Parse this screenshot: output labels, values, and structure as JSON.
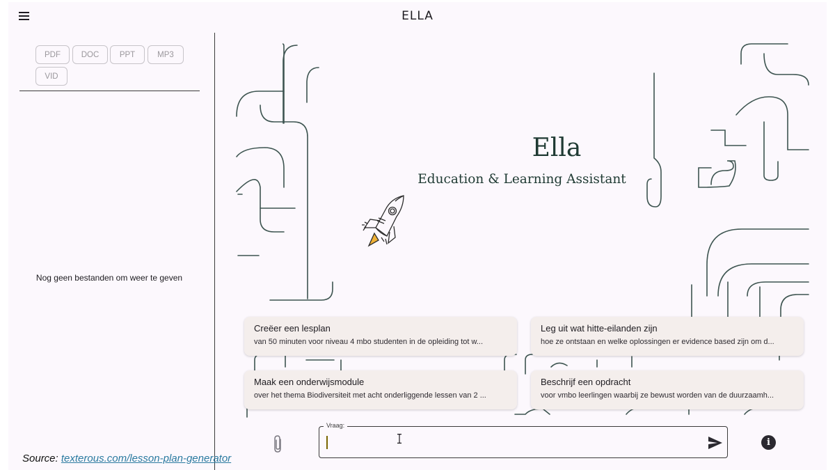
{
  "app": {
    "title": "ELLA"
  },
  "sidebar": {
    "filters": [
      "PDF",
      "DOC",
      "PPT",
      "MP3",
      "VID"
    ],
    "empty_message": "Nog geen bestanden om weer te geven"
  },
  "hero": {
    "title": "Ella",
    "subtitle": "Education & Learning Assistant"
  },
  "suggestions": [
    {
      "title": "Creëer een lesplan",
      "description": "van 50 minuten voor niveau 4 mbo studenten in de opleiding tot w..."
    },
    {
      "title": "Leg uit wat hitte-eilanden zijn",
      "description": "hoe ze ontstaan en welke oplossingen er evidence based zijn om d..."
    },
    {
      "title": "Maak een onderwijsmodule",
      "description": "over het thema Biodiversiteit met acht onderliggende lessen van 2 ..."
    },
    {
      "title": "Beschrijf een opdracht",
      "description": "voor vmbo leerlingen waarbij ze bewust worden van de duurzaamh..."
    }
  ],
  "query": {
    "label": "Vraag:",
    "value": ""
  },
  "icons": [
    "menu-icon",
    "rocket-icon",
    "paperclip-icon",
    "send-icon",
    "info-icon"
  ],
  "colors": {
    "accent": "#1f3a33",
    "background": "#fcf8fd",
    "card": "#f4eeec"
  },
  "source": {
    "label": "Source:",
    "link_text": "texterous.com/lesson-plan-generator"
  }
}
